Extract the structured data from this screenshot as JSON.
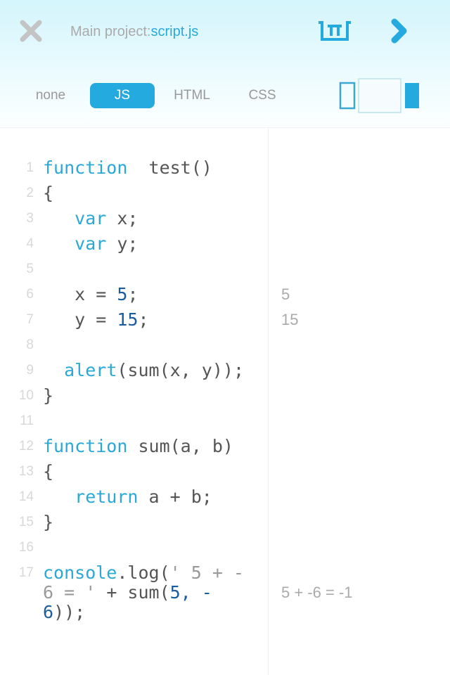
{
  "header": {
    "project_label": "Main project:",
    "file_name": "script.js"
  },
  "icons": {
    "close": "close-icon",
    "clear": "clear-output-icon",
    "run": "chevron-right-icon",
    "layout": "layout-split-icon"
  },
  "tabs": [
    {
      "label": "none",
      "active": false
    },
    {
      "label": "JS",
      "active": true
    },
    {
      "label": "HTML",
      "active": false
    },
    {
      "label": "CSS",
      "active": false
    }
  ],
  "colors": {
    "accent": "#25aadf",
    "keyword": "#2aa8d8",
    "number": "#1b5d9c",
    "text": "#555555",
    "muted": "#aaaaaa"
  },
  "code": [
    {
      "n": "1",
      "tokens": [
        [
          "kw",
          "function"
        ],
        [
          "",
          "  test()"
        ]
      ]
    },
    {
      "n": "2",
      "tokens": [
        [
          "",
          "{"
        ]
      ]
    },
    {
      "n": "3",
      "tokens": [
        [
          "",
          "   "
        ],
        [
          "kw",
          "var"
        ],
        [
          "",
          " x;"
        ]
      ]
    },
    {
      "n": "4",
      "tokens": [
        [
          "",
          "   "
        ],
        [
          "kw",
          "var"
        ],
        [
          "",
          " y;"
        ]
      ]
    },
    {
      "n": "5",
      "tokens": []
    },
    {
      "n": "6",
      "tokens": [
        [
          "",
          "   x = "
        ],
        [
          "num",
          "5"
        ],
        [
          "",
          ";"
        ]
      ]
    },
    {
      "n": "7",
      "tokens": [
        [
          "",
          "   y = "
        ],
        [
          "num",
          "15"
        ],
        [
          "",
          ";"
        ]
      ]
    },
    {
      "n": "8",
      "tokens": []
    },
    {
      "n": "9",
      "tokens": [
        [
          "",
          "  "
        ],
        [
          "kw",
          "alert"
        ],
        [
          "",
          "(sum(x, y));"
        ]
      ]
    },
    {
      "n": "10",
      "tokens": [
        [
          "",
          "}"
        ]
      ]
    },
    {
      "n": "11",
      "tokens": []
    },
    {
      "n": "12",
      "tokens": [
        [
          "kw",
          "function"
        ],
        [
          "",
          " sum(a, b)"
        ]
      ]
    },
    {
      "n": "13",
      "tokens": [
        [
          "",
          "{"
        ]
      ]
    },
    {
      "n": "14",
      "tokens": [
        [
          "",
          "   "
        ],
        [
          "kw",
          "return"
        ],
        [
          "",
          " a + b;"
        ]
      ]
    },
    {
      "n": "15",
      "tokens": [
        [
          "",
          "}"
        ]
      ]
    },
    {
      "n": "16",
      "tokens": []
    },
    {
      "n": "17",
      "tokens": [
        [
          "kw",
          "console"
        ],
        [
          "",
          ".log("
        ],
        [
          "str",
          "' 5 + -6 = '"
        ],
        [
          "",
          " + sum("
        ],
        [
          "num",
          "5, -6"
        ],
        [
          "",
          "));"
        ]
      ]
    }
  ],
  "output": [
    {
      "line": 6,
      "text": "5"
    },
    {
      "line": 7,
      "text": "15"
    },
    {
      "line": 17,
      "text": "5 + -6 = -1",
      "wrap_row": 1
    }
  ]
}
